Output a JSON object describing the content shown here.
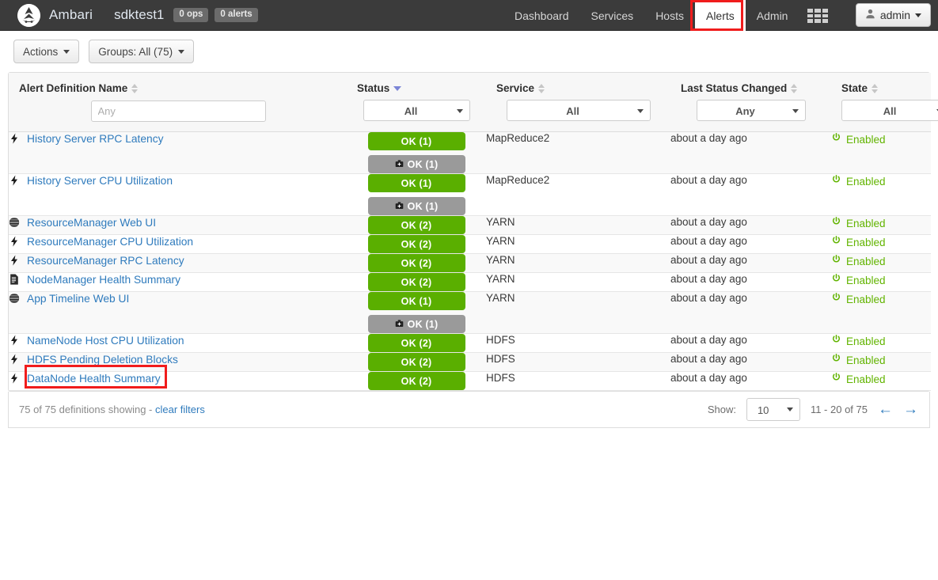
{
  "navbar": {
    "logo_icon": "ambari-logo-icon",
    "brand": "Ambari",
    "cluster": "sdktest1",
    "ops_badge": "0 ops",
    "alerts_badge": "0 alerts",
    "links": [
      {
        "label": "Dashboard",
        "active": false
      },
      {
        "label": "Services",
        "active": false
      },
      {
        "label": "Hosts",
        "active": false
      },
      {
        "label": "Alerts",
        "active": true
      },
      {
        "label": "Admin",
        "active": false
      }
    ],
    "grid_icon": "grid-apps-icon",
    "user_icon": "user-icon",
    "user": "admin",
    "highlight_color": "#f01c1c"
  },
  "toolbar": {
    "actions_label": "Actions",
    "groups_label": "Groups:  All (75)"
  },
  "table": {
    "columns": [
      {
        "key": "name",
        "label": "Alert Definition Name",
        "sorted": false
      },
      {
        "key": "status",
        "label": "Status",
        "sorted": true
      },
      {
        "key": "service",
        "label": "Service",
        "sorted": false
      },
      {
        "key": "lsc",
        "label": "Last Status Changed",
        "sorted": false
      },
      {
        "key": "state",
        "label": "State",
        "sorted": false
      }
    ],
    "filters": {
      "name_placeholder": "Any",
      "status_value": "All",
      "service_value": "All",
      "lsc_value": "Any",
      "state_value": "All"
    },
    "rows": [
      {
        "icon": "lightning-bolt-icon",
        "name": "History Server RPC Latency",
        "badges": [
          {
            "kind": "ok",
            "label": "OK (1)"
          },
          {
            "kind": "maint",
            "label": "OK (1)",
            "icon": "maintenance-icon"
          }
        ],
        "service": "MapReduce2",
        "last_changed": "about a day ago",
        "state": "Enabled",
        "highlighted": false
      },
      {
        "icon": "lightning-bolt-icon",
        "name": "History Server CPU Utilization",
        "badges": [
          {
            "kind": "ok",
            "label": "OK (1)"
          },
          {
            "kind": "maint",
            "label": "OK (1)",
            "icon": "maintenance-icon"
          }
        ],
        "service": "MapReduce2",
        "last_changed": "about a day ago",
        "state": "Enabled",
        "highlighted": false
      },
      {
        "icon": "globe-icon",
        "name": "ResourceManager Web UI",
        "badges": [
          {
            "kind": "ok",
            "label": "OK (2)"
          }
        ],
        "service": "YARN",
        "last_changed": "about a day ago",
        "state": "Enabled",
        "highlighted": false
      },
      {
        "icon": "lightning-bolt-icon",
        "name": "ResourceManager CPU Utilization",
        "badges": [
          {
            "kind": "ok",
            "label": "OK (2)"
          }
        ],
        "service": "YARN",
        "last_changed": "about a day ago",
        "state": "Enabled",
        "highlighted": false
      },
      {
        "icon": "lightning-bolt-icon",
        "name": "ResourceManager RPC Latency",
        "badges": [
          {
            "kind": "ok",
            "label": "OK (2)"
          }
        ],
        "service": "YARN",
        "last_changed": "about a day ago",
        "state": "Enabled",
        "highlighted": false
      },
      {
        "icon": "script-file-icon",
        "name": "NodeManager Health Summary",
        "badges": [
          {
            "kind": "ok",
            "label": "OK (2)"
          }
        ],
        "service": "YARN",
        "last_changed": "about a day ago",
        "state": "Enabled",
        "highlighted": false
      },
      {
        "icon": "globe-icon",
        "name": "App Timeline Web UI",
        "badges": [
          {
            "kind": "ok",
            "label": "OK (1)"
          },
          {
            "kind": "maint",
            "label": "OK (1)",
            "icon": "maintenance-icon"
          }
        ],
        "service": "YARN",
        "last_changed": "about a day ago",
        "state": "Enabled",
        "highlighted": false
      },
      {
        "icon": "lightning-bolt-icon",
        "name": "NameNode Host CPU Utilization",
        "badges": [
          {
            "kind": "ok",
            "label": "OK (2)"
          }
        ],
        "service": "HDFS",
        "last_changed": "about a day ago",
        "state": "Enabled",
        "highlighted": false
      },
      {
        "icon": "lightning-bolt-icon",
        "name": "HDFS Pending Deletion Blocks",
        "badges": [
          {
            "kind": "ok",
            "label": "OK (2)"
          }
        ],
        "service": "HDFS",
        "last_changed": "about a day ago",
        "state": "Enabled",
        "highlighted": false
      },
      {
        "icon": "lightning-bolt-icon",
        "name": "DataNode Health Summary",
        "badges": [
          {
            "kind": "ok",
            "label": "OK (2)"
          }
        ],
        "service": "HDFS",
        "last_changed": "about a day ago",
        "state": "Enabled",
        "highlighted": true
      }
    ]
  },
  "footer": {
    "summary_prefix": "75 of 75 definitions showing - ",
    "clear_filters": "clear filters",
    "show_label": "Show:",
    "page_size": "10",
    "range": "11 - 20 of 75",
    "prev_icon": "arrow-left-icon",
    "next_icon": "arrow-right-icon"
  },
  "colors": {
    "ok_green": "#5aaf00",
    "maintenance_gray": "#9a9a9a",
    "link_blue": "#2f7bbd",
    "enabled_green": "#62b400",
    "annotation_red": "#f01c1c"
  }
}
